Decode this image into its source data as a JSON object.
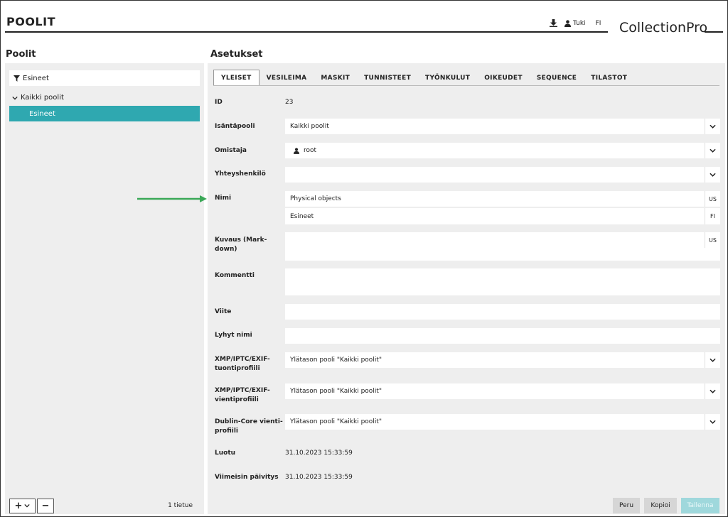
{
  "header": {
    "title": "POOLIT",
    "download_icon": "download-icon",
    "support_label": "Tuki",
    "language": "FI",
    "brand": "CollectionPro"
  },
  "left": {
    "heading": "Poolit",
    "filter_value": "Esineet",
    "tree_root": "Kaikki poolit",
    "tree_selected": "Esineet",
    "add_label": "+",
    "remove_label": "−",
    "count": "1 tietue"
  },
  "right": {
    "heading": "Asetukset",
    "tabs": [
      "YLEISET",
      "VESILEIMA",
      "MASKIT",
      "TUNNISTEET",
      "TYÖNKULUT",
      "OIKEUDET",
      "SEQUENCE",
      "TILASTOT"
    ],
    "fields": {
      "id_label": "ID",
      "id_value": "23",
      "host_label": "Isäntäpooli",
      "host_value": "Kaikki poolit",
      "owner_label": "Omistaja",
      "owner_value": "root",
      "contact_label": "Yhteyshenkilö",
      "contact_value": "",
      "name_label": "Nimi",
      "name_us": "Physical objects",
      "name_us_lang": "US",
      "name_fi": "Esineet",
      "name_fi_lang": "FI",
      "desc_label_1": "Kuvaus (Mark-",
      "desc_label_2": "down)",
      "desc_lang": "US",
      "comment_label": "Kommentti",
      "ref_label": "Viite",
      "short_label": "Lyhyt nimi",
      "xmp_import_label_1": "XMP/IPTC/EXIF-",
      "xmp_import_label_2": "tuontiprofiili",
      "xmp_import_value": "Ylätason pooli \"Kaikki poolit\"",
      "xmp_export_label_1": "XMP/IPTC/EXIF-",
      "xmp_export_label_2": "vientiprofiili",
      "xmp_export_value": "Ylätason pooli \"Kaikki poolit\"",
      "dc_label_1": "Dublin-Core vienti-",
      "dc_label_2": "profiili",
      "dc_value": "Ylätason pooli \"Kaikki poolit\"",
      "created_label": "Luotu",
      "created_value": "31.10.2023 15:33:59",
      "updated_label": "Viimeisin päivitys",
      "updated_value": "31.10.2023 15:33:59"
    },
    "buttons": {
      "cancel": "Peru",
      "copy": "Kopioi",
      "save": "Tallenna"
    }
  },
  "colors": {
    "accent": "#2fa8b0",
    "save_disabled": "#9fd8dc",
    "arrow": "#3aa857"
  }
}
